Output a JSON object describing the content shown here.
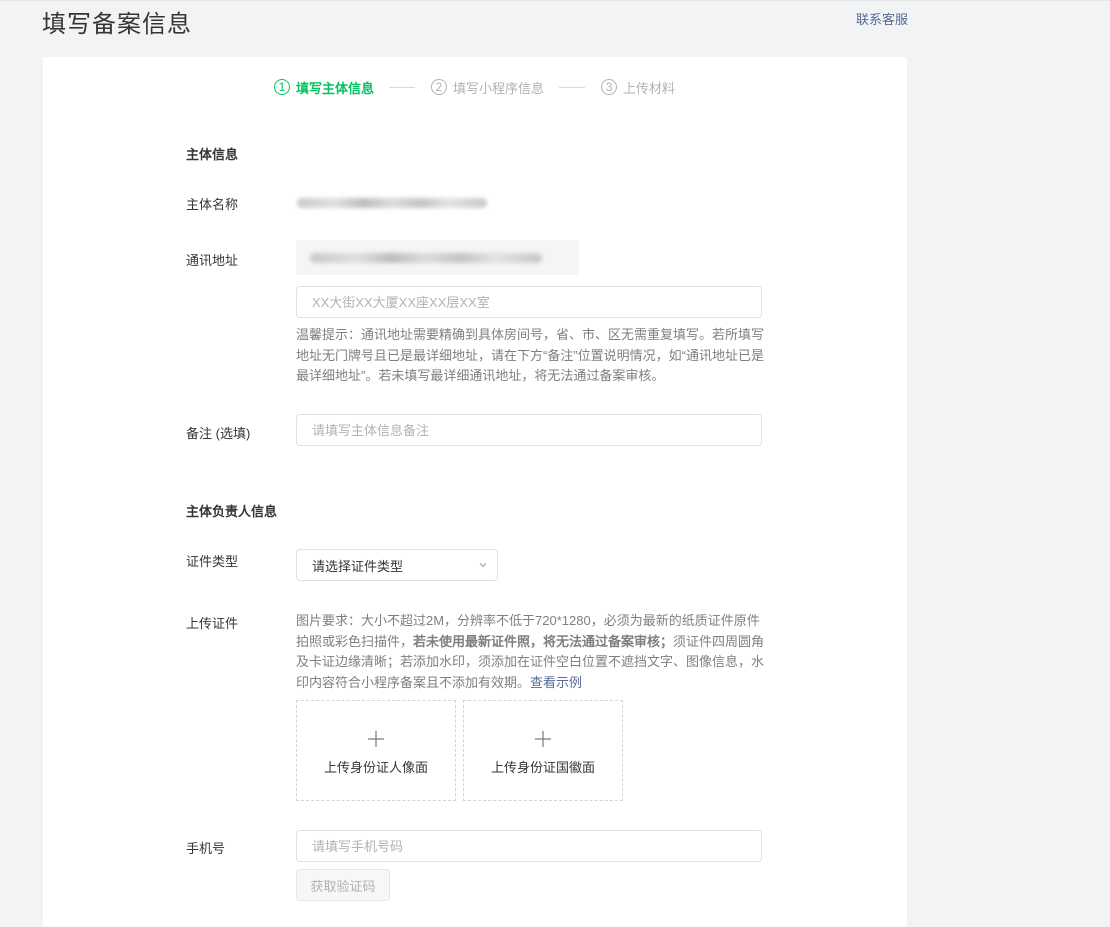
{
  "header": {
    "title": "填写备案信息",
    "contact_link": "联系客服"
  },
  "steps": [
    {
      "num": "1",
      "label": "填写主体信息",
      "active": true
    },
    {
      "num": "2",
      "label": "填写小程序信息",
      "active": false
    },
    {
      "num": "3",
      "label": "上传材料",
      "active": false
    }
  ],
  "subject_info": {
    "section_title": "主体信息",
    "name_label": "主体名称",
    "address_label": "通讯地址",
    "address_placeholder": "XX大街XX大厦XX座XX层XX室",
    "address_tip": "温馨提示：通讯地址需要精确到具体房间号，省、市、区无需重复填写。若所填写地址无门牌号且已是最详细地址，请在下方“备注”位置说明情况，如“通讯地址已是最详细地址”。若未填写最详细通讯地址，将无法通过备案审核。",
    "remark_label": "备注 (选填)",
    "remark_placeholder": "请填写主体信息备注"
  },
  "principal_info": {
    "section_title": "主体负责人信息",
    "cert_type_label": "证件类型",
    "cert_type_value": "请选择证件类型",
    "upload_label": "上传证件",
    "upload_tip_1": "图片要求：大小不超过2M，分辨率不低于720*1280，必须为最新的纸质证件原件拍照或彩色扫描件，",
    "upload_tip_bold": "若未使用最新证件照，将无法通过备案审核；",
    "upload_tip_2": "须证件四周圆角及卡证边缘清晰；若添加水印，须添加在证件空白位置不遮挡文字、图像信息，水印内容符合小程序备案且不添加有效期。",
    "upload_tip_link": "查看示例",
    "upload_front": "上传身份证人像面",
    "upload_back": "上传身份证国徽面",
    "phone_label": "手机号",
    "phone_placeholder": "请填写手机号码",
    "get_code_button": "获取验证码"
  },
  "colors": {
    "accent": "#07c160",
    "link": "#576b95",
    "muted": "#b2b2b2"
  }
}
